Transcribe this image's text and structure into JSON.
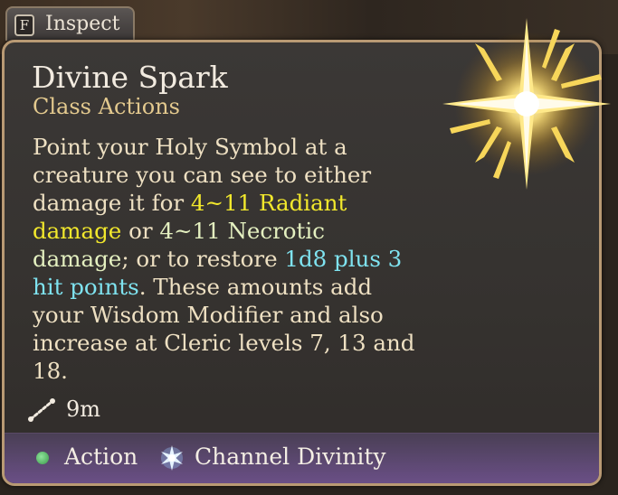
{
  "inspect": {
    "key": "F",
    "label": "Inspect"
  },
  "tooltip": {
    "title": "Divine Spark",
    "subtitle": "Class Actions",
    "description": {
      "p1": "Point your Holy Symbol at a creature you can see to either damage it for ",
      "radiant": "4~11 Radiant damage",
      "p2": " or ",
      "necrotic": "4~11 Necrotic damage",
      "p3": "; or to restore ",
      "heal": "1d8 plus 3 hit points",
      "p4": ". These amounts add your Wisdom Modifier and also increase at Cleric levels 7, 13 and 18."
    },
    "range": {
      "icon": "range-icon",
      "value": "9m"
    },
    "costs": [
      {
        "icon": "action-dot-icon",
        "label": "Action",
        "color": "#3a9a4a"
      },
      {
        "icon": "channel-divinity-icon",
        "label": "Channel Divinity",
        "color": "#cfe6ff"
      }
    ],
    "spell_icon": "divine-spark-icon"
  },
  "colors": {
    "radiant": "#f2e82c",
    "necrotic": "#e4f0c0",
    "heal": "#7fe3f0",
    "subtitle": "#e3c98e",
    "border": "#b99a74"
  }
}
